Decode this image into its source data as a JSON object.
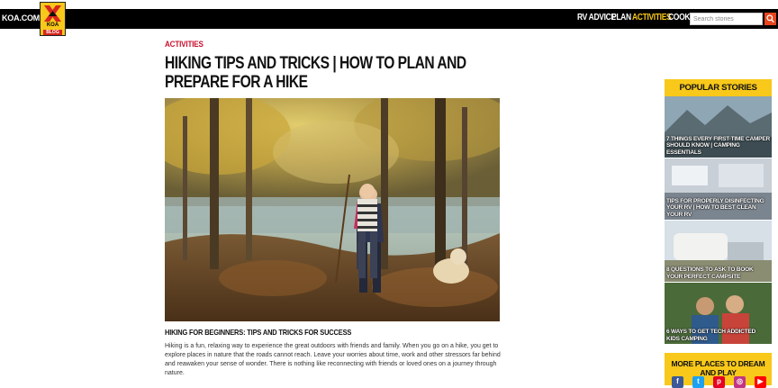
{
  "header": {
    "site_link": "KOA.COM",
    "logo_text": "KOA",
    "logo_sub": "BLOG",
    "nav": [
      {
        "label": "RV ADVICE",
        "active": false
      },
      {
        "label": "PLAN",
        "active": false
      },
      {
        "label": "ACTIVITIES",
        "active": true
      },
      {
        "label": "COOK",
        "active": false
      }
    ],
    "search_placeholder": "Search stories",
    "search_icon": "magnifier-icon"
  },
  "article": {
    "category": "ACTIVITIES",
    "title": "HIKING TIPS AND TRICKS | HOW TO PLAN AND PREPARE FOR A HIKE",
    "subhead": "HIKING FOR BEGINNERS: TIPS AND TRICKS FOR SUCCESS",
    "body": "Hiking is a fun, relaxing way to experience the great outdoors with friends and family. When you go on a hike, you get to explore places in nature that the roads cannot reach. Leave your worries about time, work and other stressors far behind and reawaken your sense of wonder. There is nothing like reconnecting with friends or loved ones on a journey through nature."
  },
  "sidebar": {
    "popular_title": "POPULAR STORIES",
    "stories": [
      {
        "title": "7 THINGS EVERY FIRST-TIME CAMPER SHOULD KNOW | CAMPING ESSENTIALS"
      },
      {
        "title": "TIPS FOR PROPERLY DISINFECTING YOUR RV | HOW TO BEST CLEAN YOUR RV"
      },
      {
        "title": "8 QUESTIONS TO ASK TO BOOK YOUR PERFECT CAMPSITE"
      },
      {
        "title": "6 WAYS TO GET TECH ADDICTED KIDS CAMPING"
      }
    ],
    "more_title": "MORE PLACES TO DREAM AND PLAY",
    "social": [
      {
        "name": "facebook-icon",
        "glyph": "f",
        "color": "#3b5998"
      },
      {
        "name": "twitter-icon",
        "glyph": "t",
        "color": "#1da1f2"
      },
      {
        "name": "pinterest-icon",
        "glyph": "p",
        "color": "#e60023"
      },
      {
        "name": "instagram-icon",
        "glyph": "◎",
        "color": "#c13584"
      },
      {
        "name": "youtube-icon",
        "glyph": "▶",
        "color": "#ff0000"
      }
    ]
  },
  "colors": {
    "accent_yellow": "#f8c81a",
    "category_red": "#c8102e",
    "search_orange": "#e8451e"
  }
}
